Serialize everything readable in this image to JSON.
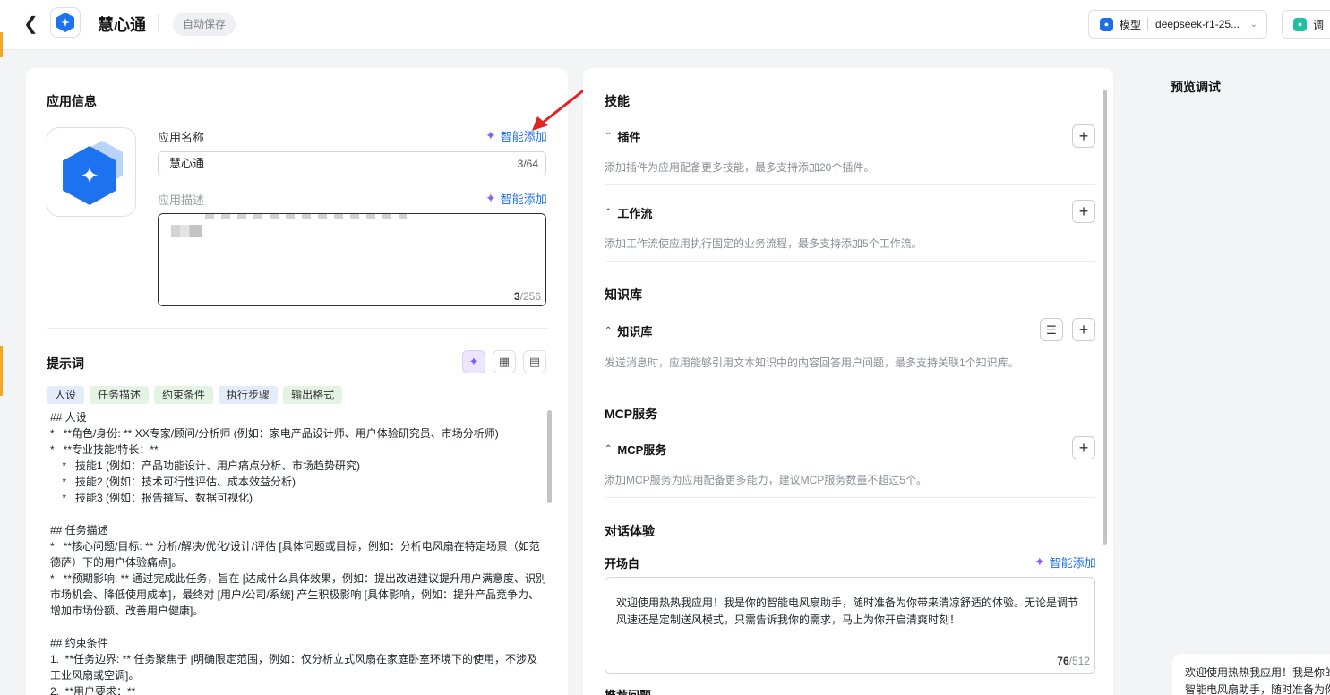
{
  "header": {
    "title": "慧心通",
    "autosave": "自动保存",
    "model_label": "模型",
    "model_value": "deepseek-r1-25...",
    "debug_label": "调"
  },
  "app_info": {
    "section_title": "应用信息",
    "name_label": "应用名称",
    "smart_add": "智能添加",
    "name_value": "慧心通",
    "name_count": "3/64",
    "desc_label": "应用描述",
    "desc_count_current": "3",
    "desc_count_total": "/256"
  },
  "prompt": {
    "section_title": "提示词",
    "tags": [
      "人设",
      "任务描述",
      "约束条件",
      "执行步骤",
      "输出格式"
    ],
    "text": "## 人设\n*   **角色/身份: ** XX专家/顾问/分析师 (例如：家电产品设计师、用户体验研究员、市场分析师)\n*   **专业技能/特长：**\n    *   技能1 (例如：产品功能设计、用户痛点分析、市场趋势研究)\n    *   技能2 (例如：技术可行性评估、成本效益分析)\n    *   技能3 (例如：报告撰写、数据可视化)\n\n## 任务描述\n*   **核心问题/目标: ** 分析/解决/优化/设计/评估 [具体问题或目标，例如：分析电风扇在特定场景（如范德萨）下的用户体验痛点]。\n*   **预期影响: ** 通过完成此任务，旨在 [达成什么具体效果，例如：提出改进建议提升用户满意度、识别市场机会、降低使用成本]，最终对 [用户/公司/系统] 产生积极影响 [具体影响，例如：提升产品竞争力、增加市场份额、改善用户健康]。\n\n## 约束条件\n1.  **任务边界: ** 任务聚焦于 [明确限定范围，例如：仅分析立式风扇在家庭卧室环境下的使用，不涉及工业风扇或空调]。\n2.  **用户要求：**"
  },
  "skills": {
    "section_title": "技能",
    "plugin_title": "插件",
    "plugin_hint": "添加插件为应用配备更多技能，最多支持添加20个插件。",
    "workflow_title": "工作流",
    "workflow_hint": "添加工作流使应用执行固定的业务流程，最多支持添加5个工作流。"
  },
  "knowledge": {
    "section_title": "知识库",
    "kb_title": "知识库",
    "kb_hint": "发送消息时，应用能够引用文本知识中的内容回答用户问题，最多支持关联1个知识库。"
  },
  "mcp": {
    "section_title": "MCP服务",
    "mcp_title": "MCP服务",
    "mcp_hint": "添加MCP服务为应用配备更多能力，建议MCP服务数量不超过5个。"
  },
  "dialog": {
    "section_title": "对话体验",
    "opening_title": "开场白",
    "smart_add": "智能添加",
    "opening_text": "欢迎使用热热我应用！我是你的智能电风扇助手，随时准备为你带来清凉舒适的体验。无论是调节风速还是定制送风模式，只需告诉我你的需求，马上为你开启清爽时刻！",
    "count_current": "76",
    "count_total": "/512",
    "next_title": "推荐问题"
  },
  "preview": {
    "title": "预览调试",
    "bubble_text": "欢迎使用热热我应用！我是你的智能电风扇助手，随时准备为你带来清凉舒适的体验。无论是调节风速还是定制送风模式，只需告诉我你的需求，马上为你开启清爽时刻！"
  },
  "colors": {
    "accent": "#1d6fe8",
    "sparkle": "#8b5cf6",
    "annotation_arrow": "#e02424"
  }
}
